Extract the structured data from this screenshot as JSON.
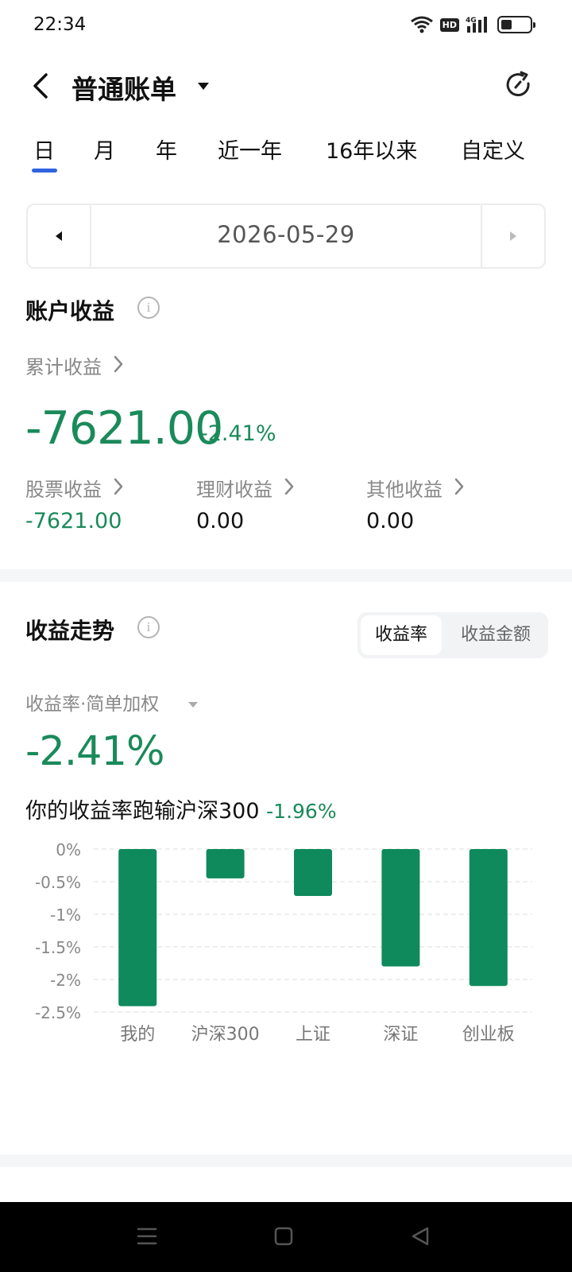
{
  "status_bar": {
    "time": "22:34",
    "hd_badge": "HD",
    "network_type": "4G",
    "battery_level": 0.35
  },
  "header": {
    "title": "普通账单"
  },
  "period_tabs": {
    "items": [
      "日",
      "月",
      "年",
      "近一年",
      "16年以来",
      "自定义"
    ],
    "selected": "日"
  },
  "date_selector": {
    "date": "2026-05-29"
  },
  "account": {
    "title": "账户收益",
    "cumulative_label": "累计收益",
    "cumulative_value": "-7621.00",
    "cumulative_pct": "-2.41%",
    "breakdown": [
      {
        "label": "股票收益",
        "value": "-7621.00"
      },
      {
        "label": "理财收益",
        "value": "0.00"
      },
      {
        "label": "其他收益",
        "value": "0.00"
      }
    ]
  },
  "trend": {
    "title": "收益走势",
    "toggle": {
      "active": "收益率",
      "inactive": "收益金额"
    },
    "metric_label": "收益率·简单加权",
    "rate": "-2.41%",
    "compare_text": "你的收益率跑输沪深300",
    "compare_pct": "-1.96%"
  },
  "colors": {
    "positive_green": "#1a8a5a",
    "bar_green": "#0e8a5c",
    "tab_accent": "#2f63e0"
  },
  "icons": {
    "back": "back-chevron-icon",
    "refresh": "refresh-icon",
    "info": "info-icon",
    "nav": [
      "menu-icon",
      "home-square-icon",
      "back-triangle-icon"
    ]
  },
  "chart_data": {
    "type": "bar",
    "categories": [
      "我的",
      "沪深300",
      "上证",
      "深证",
      "创业板"
    ],
    "values": [
      -2.41,
      -0.45,
      -0.72,
      -1.8,
      -2.1
    ],
    "ylim": [
      -2.5,
      0
    ],
    "yticks": [
      0,
      -0.5,
      -1,
      -1.5,
      -2,
      -2.5
    ],
    "ytick_labels": [
      "0%",
      "-0.5%",
      "-1%",
      "-1.5%",
      "-2%",
      "-2.5%"
    ],
    "grid": true
  }
}
